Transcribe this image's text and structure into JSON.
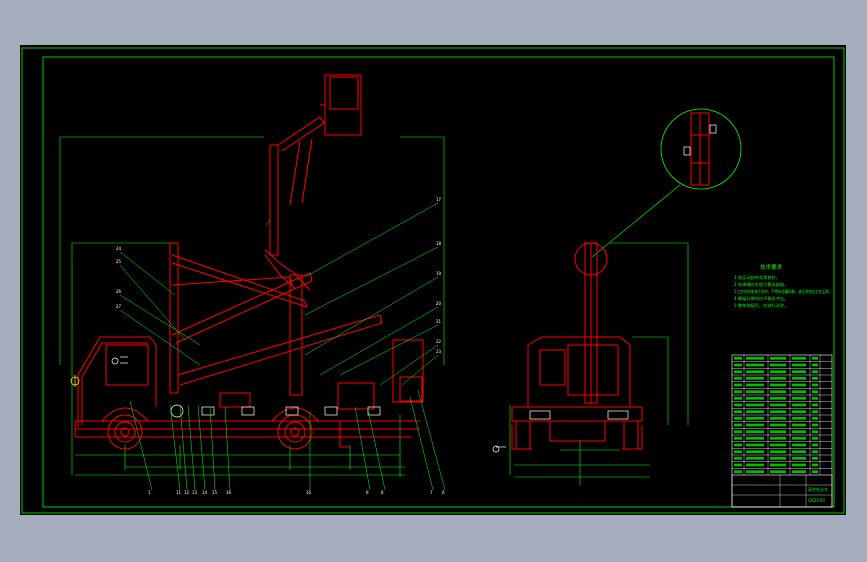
{
  "canvas": {
    "background": "#a4aebd",
    "viewport_background": "#000000",
    "colors": {
      "frame": "#00ff00",
      "red": "#ff0000",
      "white": "#ffffff",
      "yellow": "#ffff00",
      "magenta": "#ff00ff",
      "cyan": "#00ffff"
    }
  },
  "drawing": {
    "tech_requirements_title": "技术要求",
    "tech_requirements": [
      "1.各运动部件润滑良好。",
      "2.各焊缝应牢固可靠无缺陷。",
      "3.工作前检查液压系统，不得有泄漏现象，液压系统应工作正常。",
      "4.臂架升降时应平稳无冲击。",
      "5.整车装配后，应进行试验。"
    ],
    "balloon_labels_bottom": [
      "1",
      "11",
      "12",
      "13",
      "14",
      "15",
      "16",
      "10",
      "9",
      "8",
      "7",
      "6"
    ],
    "balloon_labels_top_right": [
      "17",
      "18",
      "19",
      "20",
      "21",
      "22",
      "23"
    ],
    "balloon_labels_left": [
      "24",
      "25",
      "26",
      "27"
    ],
    "title_block": {
      "drawing_name": "高空作业车",
      "drawing_no": "GKZY-00"
    }
  }
}
